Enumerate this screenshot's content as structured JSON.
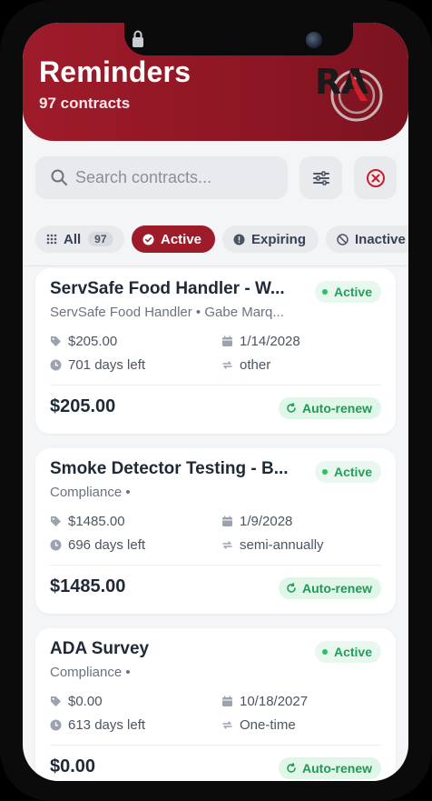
{
  "header": {
    "title": "Reminders",
    "subtitle": "97 contracts",
    "logo_text": "RA"
  },
  "search": {
    "placeholder": "Search contracts...",
    "value": ""
  },
  "chips": [
    {
      "label": "All",
      "count": "97",
      "icon": "grid-icon"
    },
    {
      "label": "Active",
      "icon": "check-circle-icon"
    },
    {
      "label": "Expiring",
      "icon": "alert-circle-icon"
    },
    {
      "label": "Inactive",
      "icon": "ban-icon"
    }
  ],
  "contracts": [
    {
      "name": "ServSafe Food Handler - W...",
      "subtitle": "ServSafe Food Handler • Gabe Marq...",
      "status": "Active",
      "price": "$205.00",
      "date": "1/14/2028",
      "days_left": "701 days left",
      "frequency": "other",
      "amount": "$205.00",
      "renew": "Auto-renew"
    },
    {
      "name": "Smoke Detector Testing - B...",
      "subtitle": "Compliance •",
      "status": "Active",
      "price": "$1485.00",
      "date": "1/9/2028",
      "days_left": "696 days left",
      "frequency": "semi-annually",
      "amount": "$1485.00",
      "renew": "Auto-renew"
    },
    {
      "name": "ADA Survey",
      "subtitle": "Compliance •",
      "status": "Active",
      "price": "$0.00",
      "date": "10/18/2027",
      "days_left": "613 days left",
      "frequency": "One-time",
      "amount": "$0.00",
      "renew": "Auto-renew"
    }
  ],
  "colors": {
    "brand": "#9e1b2a",
    "active_green": "#22a05a",
    "chip_bg": "#e8eaed"
  }
}
